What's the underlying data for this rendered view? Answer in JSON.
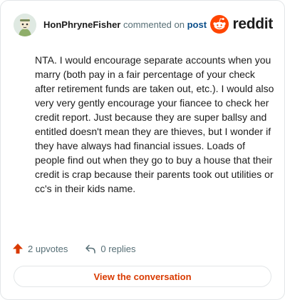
{
  "comment": {
    "username": "HonPhryneFisher",
    "commented_on_text": "commented on",
    "post_link_text": "post",
    "body": "NTA. I would encourage separate accounts when you marry (both pay in a fair percentage of your check after retirement funds are taken out, etc.). I would also very very gently encourage your fiancee to check her credit report. Just because they are super ballsy and entitled doesn't mean they are thieves, but I wonder if they have always had financial issues. Loads of people find out when they go to buy a house that their credit is crap because their parents took out utilities or cc's in their kids name."
  },
  "brand": {
    "name": "reddit",
    "color": "#ff4500"
  },
  "actions": {
    "upvotes_label": "2 upvotes",
    "replies_label": "0 replies"
  },
  "cta": {
    "label": "View the conversation"
  },
  "colors": {
    "upvote_arrow": "#d93a00",
    "cta_text": "#d93a00",
    "post_link": "#0b4e89",
    "muted_text": "#576f76"
  }
}
